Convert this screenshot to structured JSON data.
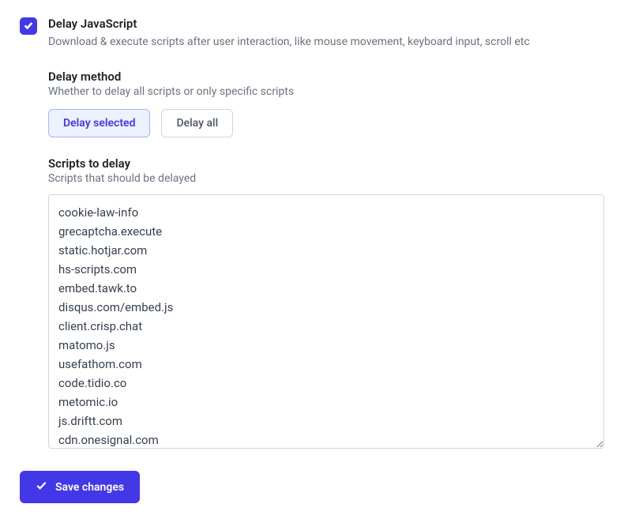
{
  "delay_js": {
    "title": "Delay JavaScript",
    "description": "Download & execute scripts after user interaction, like mouse movement, keyboard input, scroll etc",
    "checked": true
  },
  "delay_method": {
    "title": "Delay method",
    "description": "Whether to delay all scripts or only specific scripts",
    "options": {
      "selected": "Delay selected",
      "all": "Delay all"
    }
  },
  "scripts_to_delay": {
    "title": "Scripts to delay",
    "description": "Scripts that should be delayed",
    "value": "cookie-law-info\ngrecaptcha.execute\nstatic.hotjar.com\nhs-scripts.com\nembed.tawk.to\ndisqus.com/embed.js\nclient.crisp.chat\nmatomo.js\nusefathom.com\ncode.tidio.co\nmetomic.io\njs.driftt.com\ncdn.onesignal.com"
  },
  "save_button": {
    "label": "Save changes"
  }
}
